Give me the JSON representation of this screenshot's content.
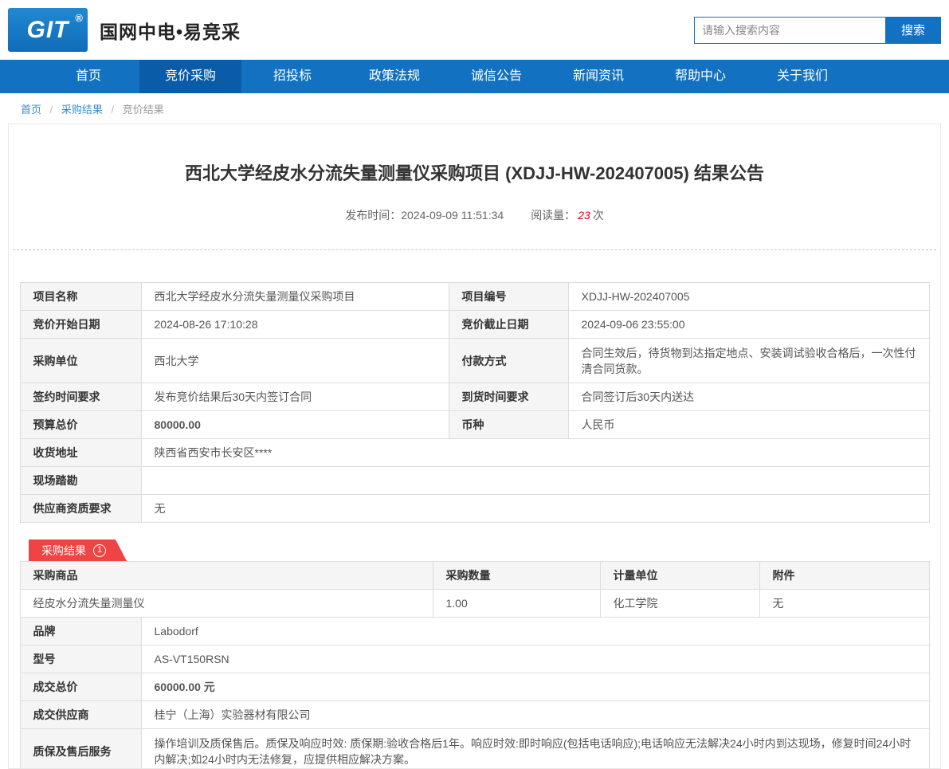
{
  "header": {
    "logo_text": "GIT",
    "logo_reg": "®",
    "site_title": "国网中电•易竞采",
    "search_placeholder": "请输入搜索内容",
    "search_button": "搜索"
  },
  "nav": {
    "items": [
      {
        "label": "首页"
      },
      {
        "label": "竞价采购",
        "active": true
      },
      {
        "label": "招投标"
      },
      {
        "label": "政策法规"
      },
      {
        "label": "诚信公告"
      },
      {
        "label": "新闻资讯"
      },
      {
        "label": "帮助中心"
      },
      {
        "label": "关于我们"
      }
    ]
  },
  "breadcrumb": {
    "separator": "/",
    "items": [
      "首页",
      "采购结果",
      "竞价结果"
    ]
  },
  "article": {
    "title": "西北大学经皮水分流失量测量仪采购项目 (XDJJ-HW-202407005) 结果公告",
    "publish_label": "发布时间：",
    "publish_time": "2024-09-09 11:51:34",
    "views_label": "阅读量：",
    "views_count": "23",
    "views_unit": "次"
  },
  "info": {
    "rows": [
      {
        "l1": "项目名称",
        "v1": "西北大学经皮水分流失量测量仪采购项目",
        "l2": "项目编号",
        "v2": "XDJJ-HW-202407005"
      },
      {
        "l1": "竞价开始日期",
        "v1": "2024-08-26 17:10:28",
        "l2": "竞价截止日期",
        "v2": "2024-09-06 23:55:00"
      },
      {
        "l1": "采购单位",
        "v1": "西北大学",
        "l2": "付款方式",
        "v2": "合同生效后，待货物到达指定地点、安装调试验收合格后，一次性付清合同货款。"
      },
      {
        "l1": "签约时间要求",
        "v1": "发布竞价结果后30天内签订合同",
        "l2": "到货时间要求",
        "v2": "合同签订后30天内送达"
      },
      {
        "l1": "预算总价",
        "v1": "80000.00",
        "l2": "币种",
        "v2": "人民币"
      },
      {
        "l1": "收货地址",
        "v1": "陕西省西安市长安区****"
      },
      {
        "l1": "现场踏勘",
        "v1": ""
      },
      {
        "l1": "供应商资质要求",
        "v1": "无"
      }
    ]
  },
  "result": {
    "ribbon_label": "采购结果",
    "ribbon_count": "1",
    "product_headers": [
      "采购商品",
      "采购数量",
      "计量单位",
      "附件"
    ],
    "product_row": [
      "经皮水分流失量测量仪",
      "1.00",
      "化工学院",
      "无"
    ],
    "detail_rows": [
      {
        "label": "品牌",
        "value": "Labodorf"
      },
      {
        "label": "型号",
        "value": "AS-VT150RSN"
      },
      {
        "label": "成交总价",
        "value": "60000.00 元"
      },
      {
        "label": "成交供应商",
        "value": "桂宁（上海）实验器材有限公司"
      },
      {
        "label": "质保及售后服务",
        "value": "操作培训及质保售后。质保及响应时效: 质保期:验收合格后1年。响应时效:即时响应(包括电话响应);电话响应无法解决24小时内到达现场，修复时间24小时内解决;如24小时内无法修复，应提供相应解决方案。"
      }
    ]
  },
  "colors": {
    "nav_blue": "#1272c1",
    "nav_active_blue": "#0a5ca8",
    "price_red": "#e60012",
    "ribbon_red": "#ef4444"
  }
}
